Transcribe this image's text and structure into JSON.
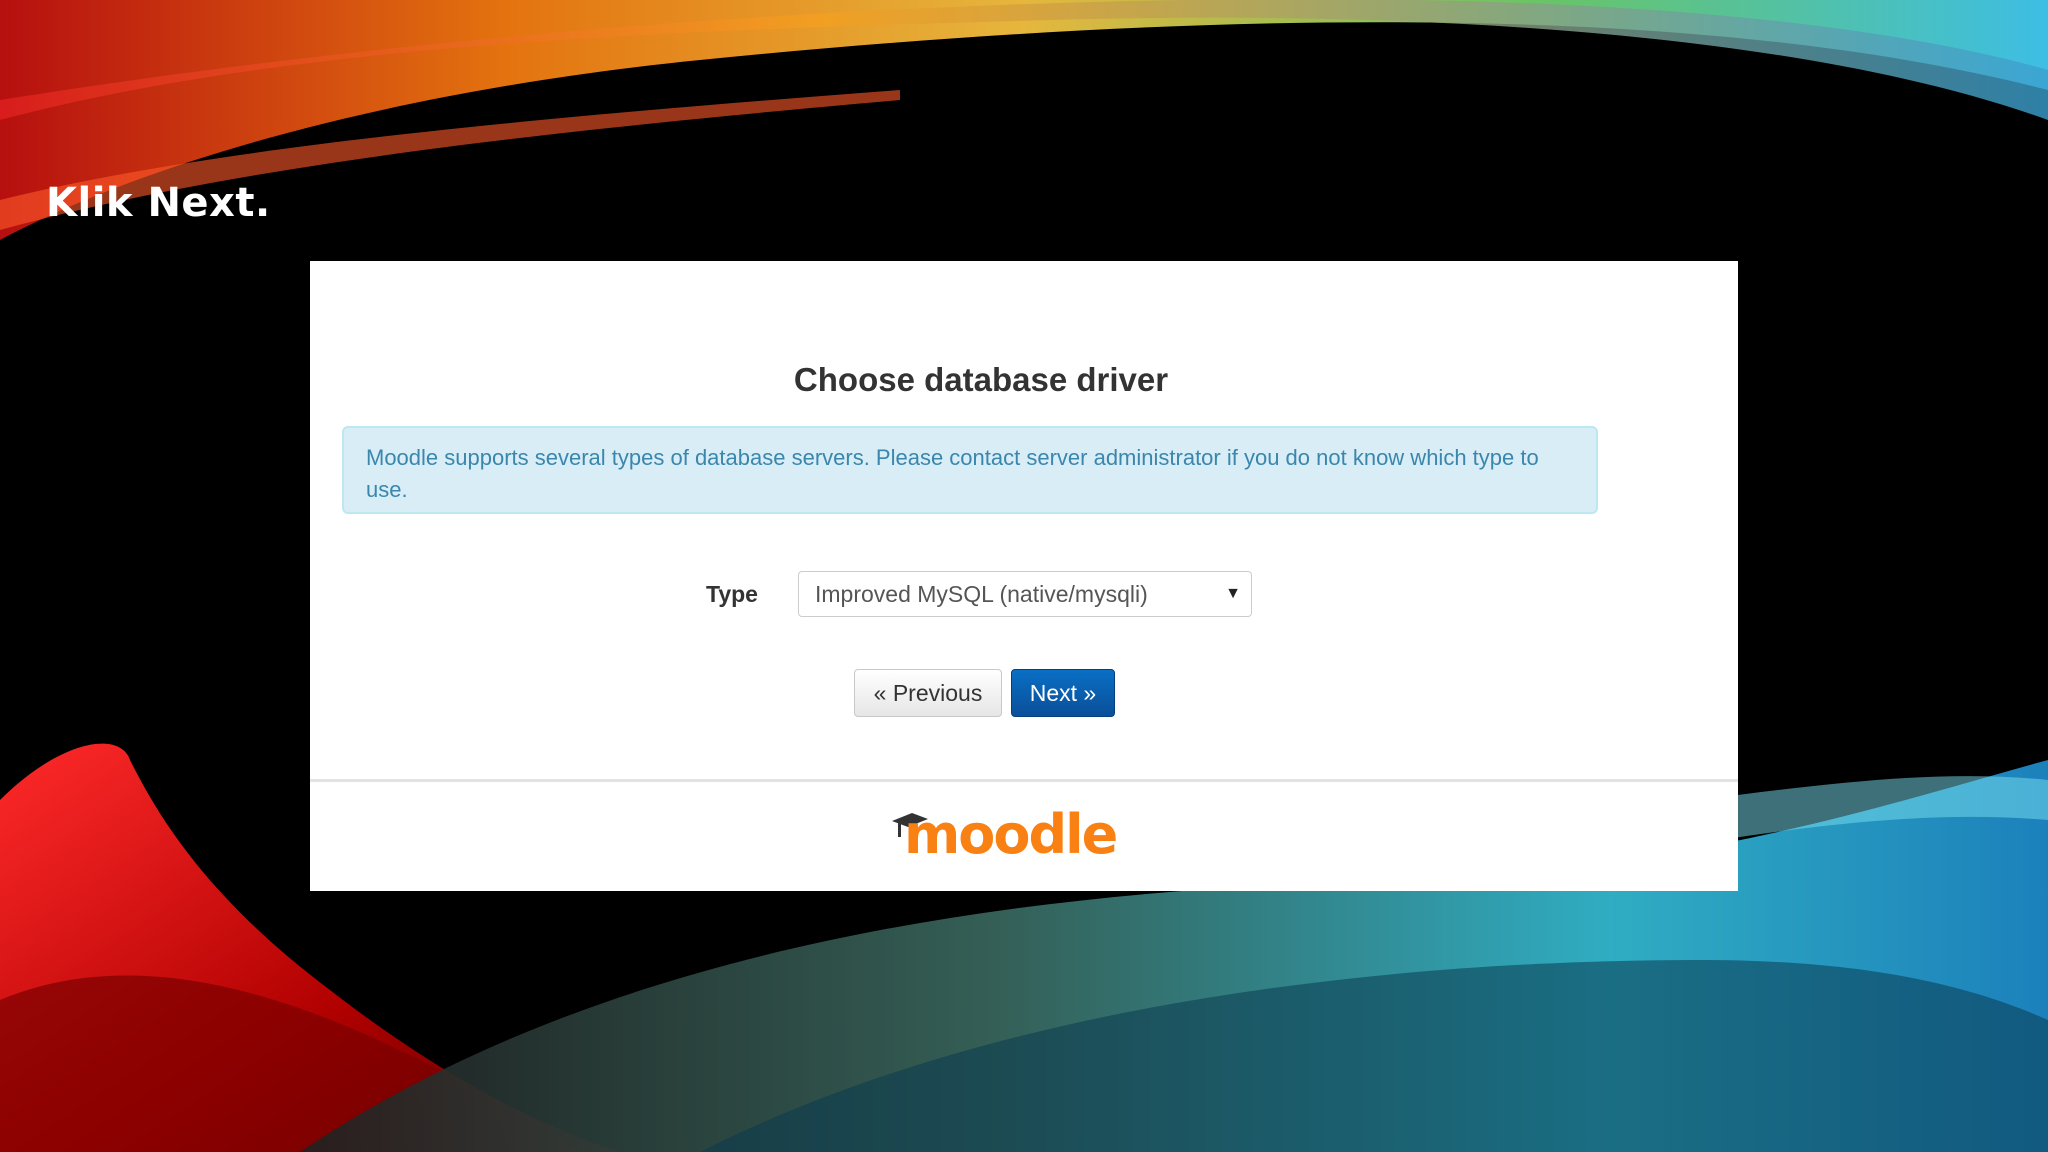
{
  "slide": {
    "title": "Klik Next."
  },
  "installer": {
    "heading": "Choose database driver",
    "notice": "Moodle supports several types of database servers. Please contact server administrator if you do not know which type to use.",
    "type_label": "Type",
    "type_select": {
      "selected": "Improved MySQL (native/mysqli)"
    },
    "buttons": {
      "previous": "« Previous",
      "next": "Next »"
    }
  },
  "footer": {
    "logo_text": "moodle",
    "logo_color": "#f98012"
  },
  "colors": {
    "alert_bg": "#d9edf7",
    "alert_text": "#3a87ad",
    "primary_button": "#0a5aa8"
  }
}
